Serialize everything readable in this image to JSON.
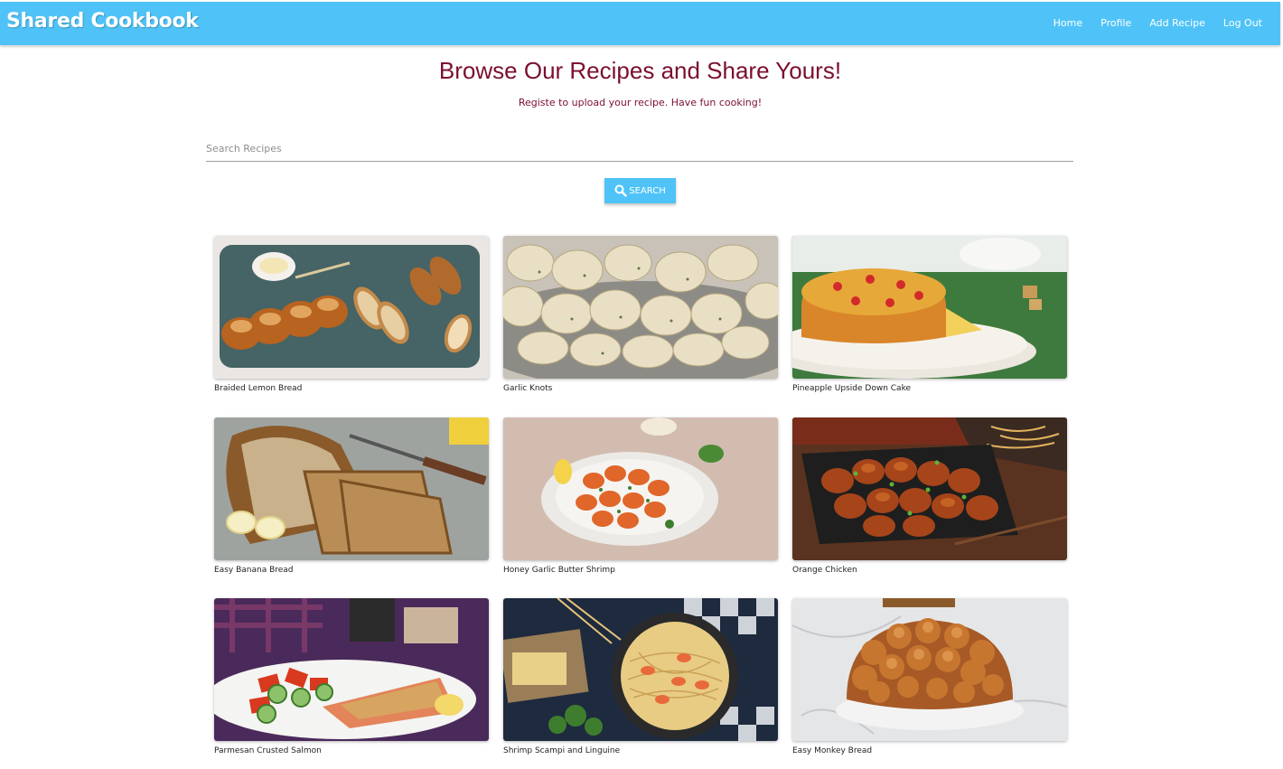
{
  "navbar": {
    "brand": "Shared Cookbook",
    "links": [
      "Home",
      "Profile",
      "Add Recipe",
      "Log Out"
    ]
  },
  "header": {
    "title": "Browse Our Recipes and Share Yours!",
    "subtitle": "Registe to upload your recipe. Have fun cooking!"
  },
  "search": {
    "placeholder": "Search Recipes",
    "button_label": "SEARCH",
    "button_icon": "search-icon"
  },
  "colors": {
    "accent": "#4fc3f7",
    "heading": "#7b0f2e"
  },
  "recipes": [
    {
      "title": "Braided Lemon Bread"
    },
    {
      "title": "Garlic Knots"
    },
    {
      "title": "Pineapple Upside Down Cake"
    },
    {
      "title": "Easy Banana Bread"
    },
    {
      "title": "Honey Garlic Butter Shrimp"
    },
    {
      "title": "Orange Chicken"
    },
    {
      "title": "Parmesan Crusted Salmon"
    },
    {
      "title": "Shrimp Scampi and Linguine"
    },
    {
      "title": "Easy Monkey Bread"
    }
  ]
}
